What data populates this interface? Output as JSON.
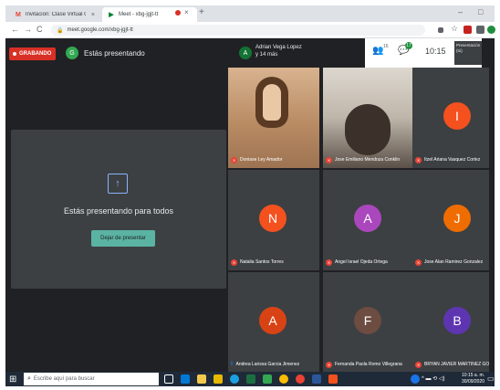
{
  "browser": {
    "tabs": [
      {
        "label": "Invitación: Clase Virtual Orienta",
        "favicon": "gmail-icon",
        "favicon_color": "#ea4335"
      },
      {
        "label": "Meet - xbg-jgjt-tt",
        "favicon": "meet-icon",
        "favicon_color": "#00832d"
      }
    ],
    "tab_close": "×",
    "new_tab": "+",
    "url": "meet.google.com/xbg-jgjt-tt",
    "window_controls": {
      "minimize": "–",
      "maximize": "□"
    }
  },
  "meet": {
    "recording_label": "GRABANDO",
    "presenter_initial": "G",
    "presenting_title": "Estás presentando",
    "present_message": "Estás presentando para todos",
    "stop_presenting_button": "Dejar de presentar",
    "host_initial": "A",
    "host_name": "Adrian Vega Lopez",
    "host_more": "y 14 más",
    "people_count": "16",
    "chat_count": "17",
    "clock": "10:15",
    "presentation_thumb": "Presentación (tú)",
    "participants": [
      {
        "name": "Doniase Ley Amador",
        "initial": "",
        "color": "",
        "video": "a",
        "speaking": false
      },
      {
        "name": "Jose Emiliano Mendoza Conklin",
        "initial": "",
        "color": "",
        "video": "b",
        "speaking": false
      },
      {
        "name": "Itzel Ariana Vasquez Cortez",
        "initial": "I",
        "color": "#f4511e",
        "video": "",
        "speaking": false
      },
      {
        "name": "Natalia Santos Torres",
        "initial": "N",
        "color": "#f4511e",
        "video": "",
        "speaking": false
      },
      {
        "name": "Angel Israel Ojeda Ortega",
        "initial": "A",
        "color": "#ab47bc",
        "video": "",
        "speaking": false
      },
      {
        "name": "Jose Alan Ramirez Gonzalez",
        "initial": "J",
        "color": "#ef6c00",
        "video": "",
        "speaking": false
      },
      {
        "name": "Andrea Larissa Garcia Jimenez",
        "initial": "A",
        "color": "#d84315",
        "video": "",
        "speaking": true
      },
      {
        "name": "Fernanda Paola Romo Villegrana",
        "initial": "F",
        "color": "#6d4c41",
        "video": "",
        "speaking": false
      },
      {
        "name": "BRYAN JAVIER MARTINEZ GO",
        "initial": "B",
        "color": "#5e35b1",
        "video": "",
        "speaking": false
      }
    ]
  },
  "taskbar": {
    "search_placeholder": "Escribe aquí para buscar",
    "time": "10:15 a. m.",
    "date": "30/09/2020"
  }
}
